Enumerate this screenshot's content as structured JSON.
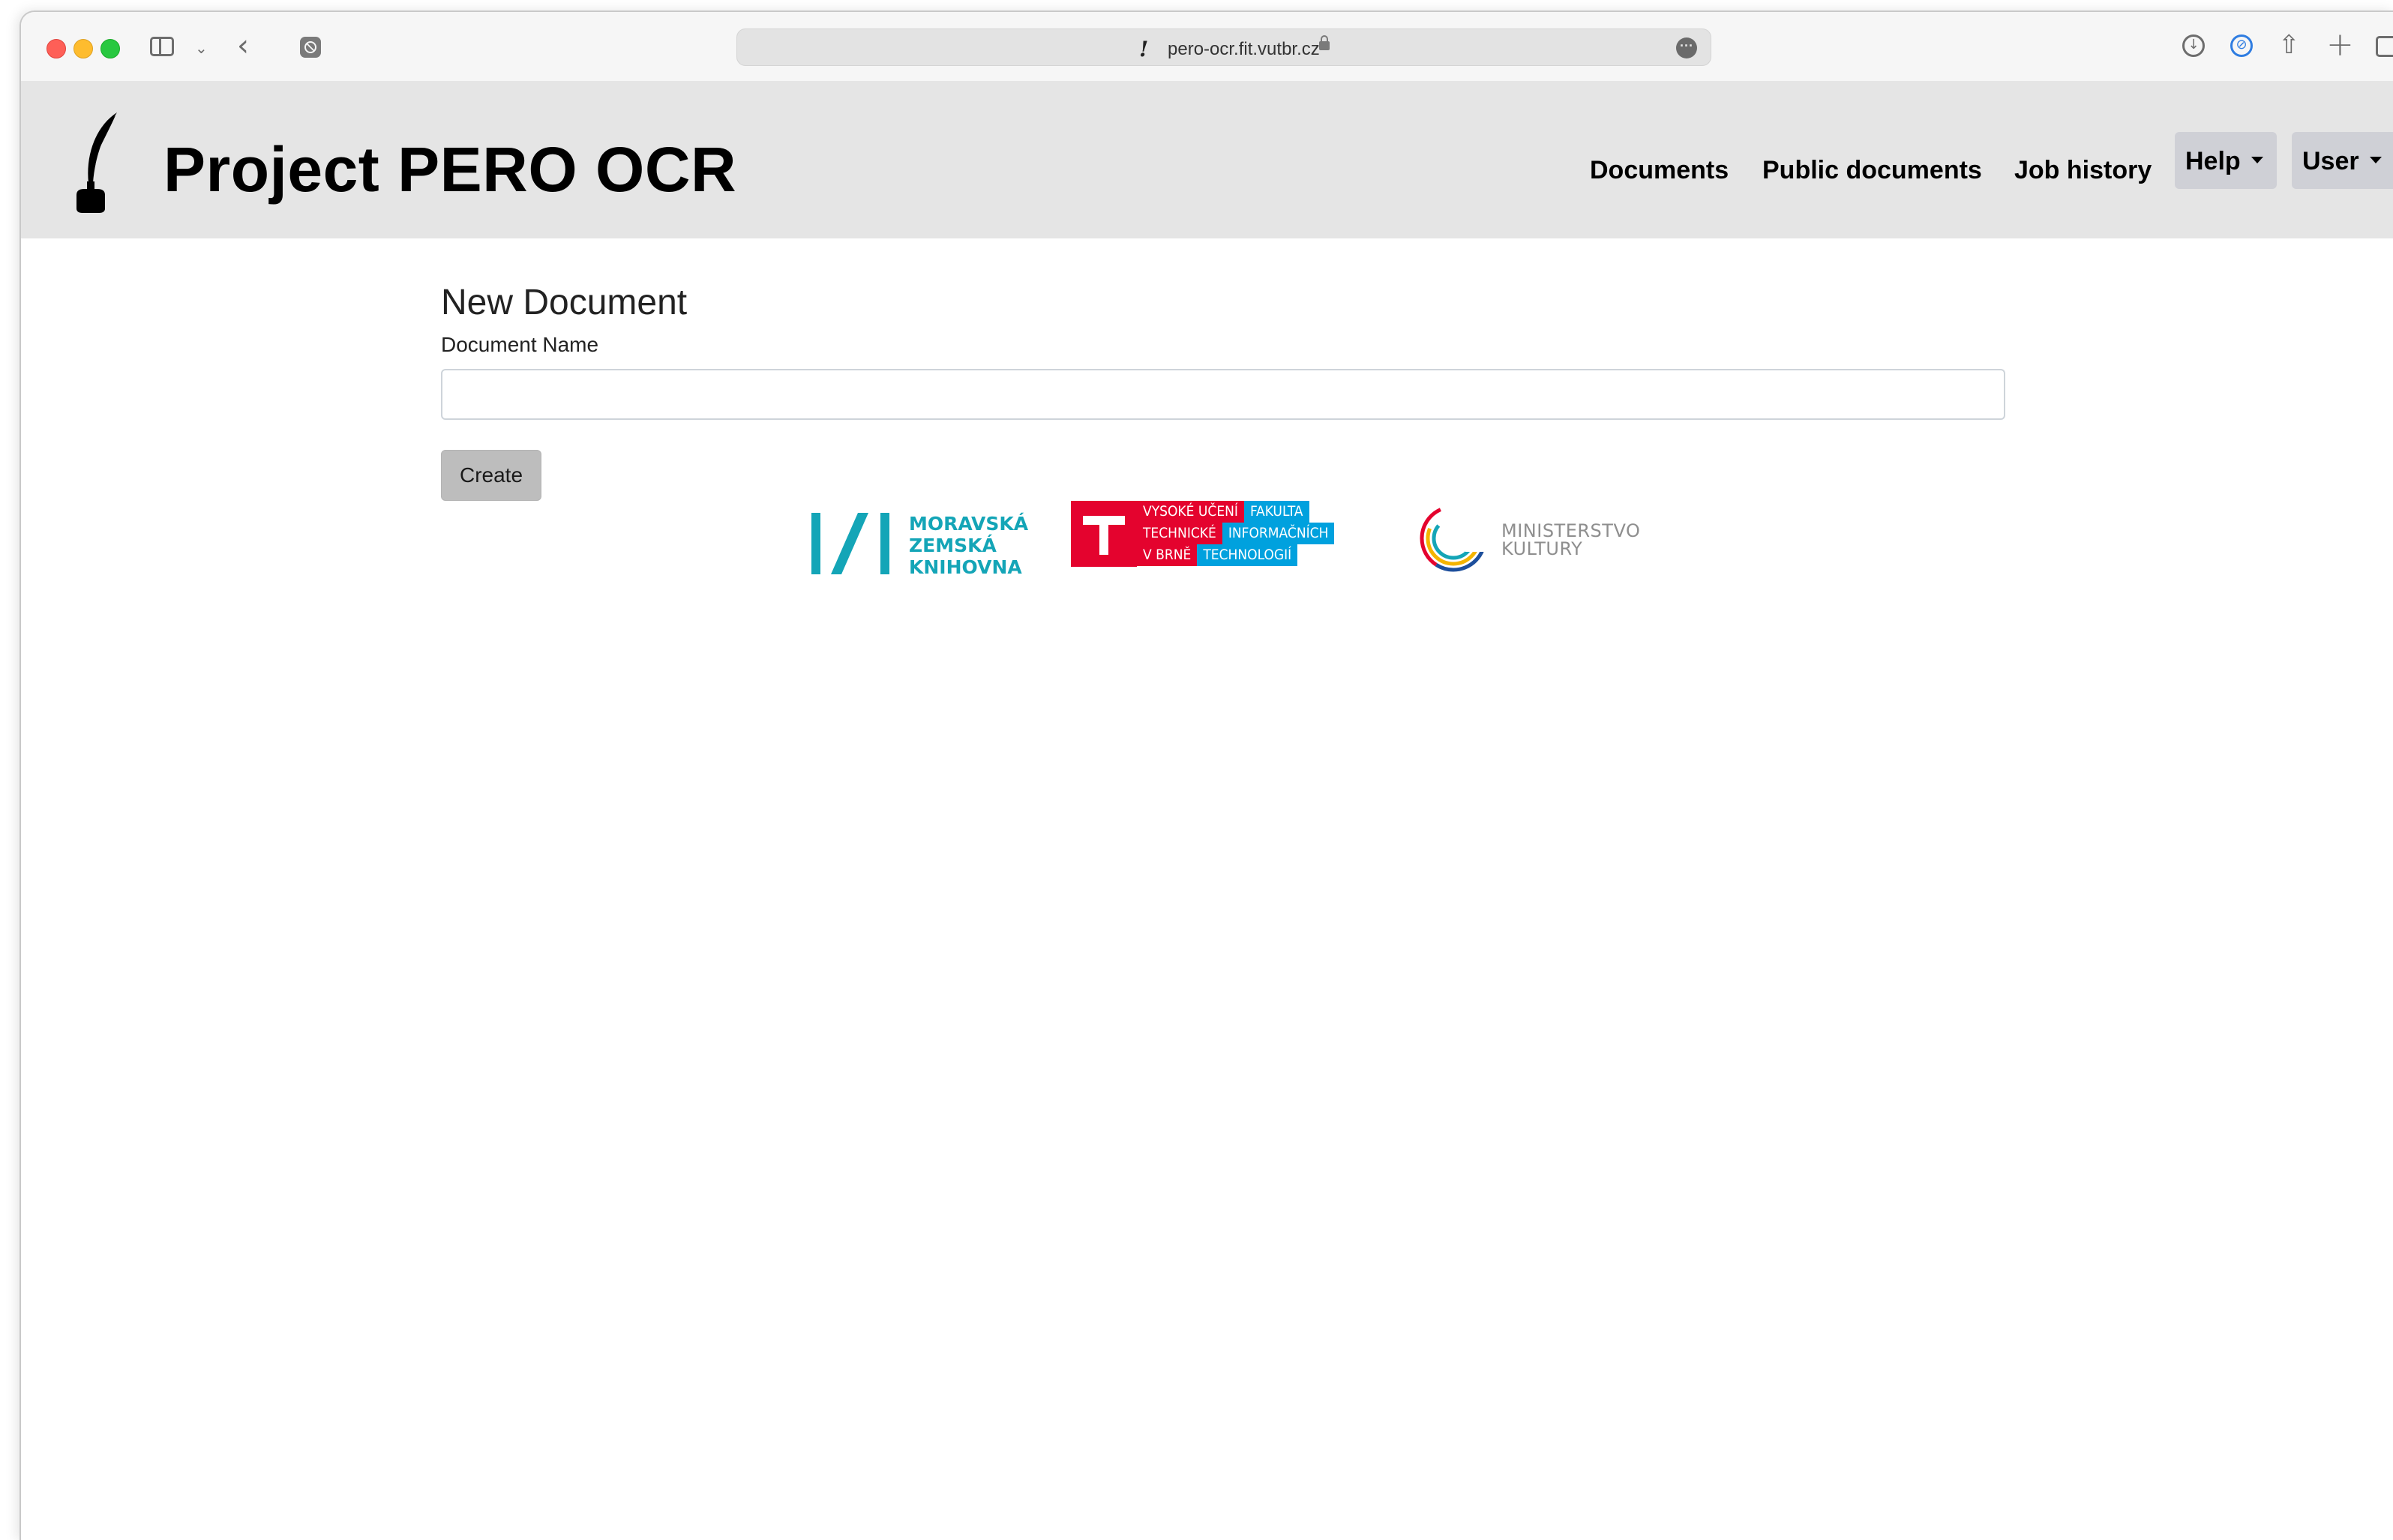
{
  "browser": {
    "url": "pero-ocr.fit.vutbr.cz",
    "icons": [
      "sidebar-icon",
      "chevron-down-icon",
      "back-arrow-icon",
      "privacy-icon",
      "favicon-quill-icon",
      "lock-icon",
      "more-icon",
      "download-icon",
      "extension-icon",
      "share-icon",
      "new-tab-icon",
      "tab-overview-icon"
    ]
  },
  "header": {
    "title": "Project PERO OCR",
    "nav": {
      "documents": "Documents",
      "public_documents": "Public documents",
      "job_history": "Job history",
      "help": "Help",
      "user": "User"
    }
  },
  "main": {
    "title": "New Document",
    "name_label": "Document Name",
    "name_value": "",
    "create_label": "Create"
  },
  "partners": {
    "mzk": [
      "MORAVSKÁ",
      "ZEMSKÁ",
      "KNIHOVNA"
    ],
    "vut": {
      "row1_red": "VYSOKÉ UČENÍ",
      "row1_blue": "FAKULTA",
      "row2_red": "TECHNICKÉ",
      "row2_blue": "INFORMAČNÍCH",
      "row3_red": "V BRNĚ",
      "row3_blue": "TECHNOLOGIÍ"
    },
    "mk": [
      "MINISTERSTVO",
      "KULTURY"
    ]
  },
  "colors": {
    "header_bg": "#e5e5e5",
    "dropdown_bg": "#cfd0d6",
    "button_bg": "#bdbdbd",
    "mzk_teal": "#14a5b7",
    "vut_red": "#e4032e",
    "vut_blue": "#00a1de"
  }
}
